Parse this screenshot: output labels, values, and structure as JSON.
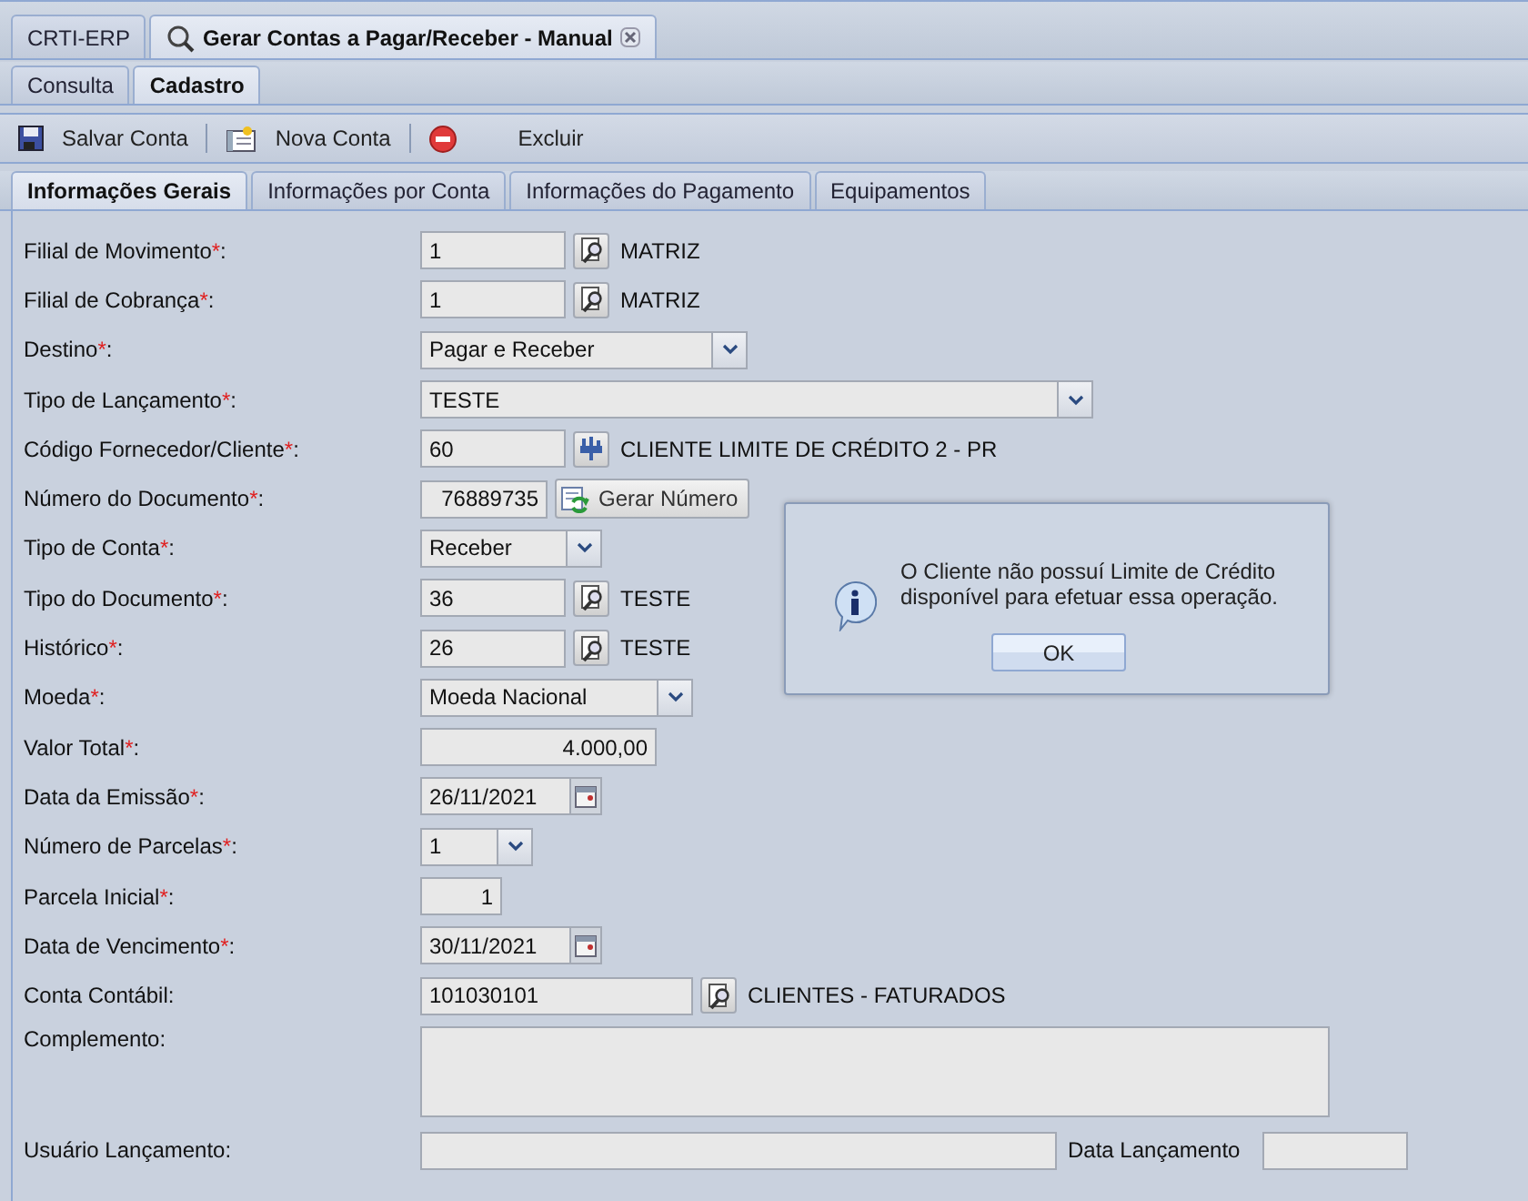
{
  "window_tabs": [
    {
      "label": "CRTI-ERP",
      "selected": false,
      "closable": false
    },
    {
      "label": "Gerar Contas a Pagar/Receber - Manual",
      "selected": true,
      "closable": true
    }
  ],
  "sub_tabs": [
    {
      "label": "Consulta",
      "selected": false
    },
    {
      "label": "Cadastro",
      "selected": true
    }
  ],
  "toolbar": [
    {
      "kind": "save",
      "label": "Salvar Conta"
    },
    {
      "kind": "new",
      "label": "Nova Conta"
    },
    {
      "kind": "delete",
      "label": "Excluir"
    }
  ],
  "form_tabs": [
    {
      "label": "Informações Gerais",
      "selected": true
    },
    {
      "label": "Informações por Conta",
      "selected": false
    },
    {
      "label": "Informações do Pagamento",
      "selected": false
    },
    {
      "label": "Equipamentos",
      "selected": false
    }
  ],
  "fields": [
    {
      "label": "Filial de Movimento",
      "mark": "*",
      "end": ":",
      "kind": "lookup",
      "value": "1",
      "description": "MATRIZ"
    },
    {
      "label": "Filial de Cobrança",
      "mark": "*",
      "end": ":",
      "kind": "lookup",
      "value": "1",
      "description": "MATRIZ"
    },
    {
      "label": "Destino",
      "mark": "*",
      "end": ":",
      "kind": "select",
      "value": "Pagar e Receber"
    },
    {
      "label": "Tipo de Lançamento",
      "mark": "*",
      "end": ":",
      "kind": "select",
      "value": "TESTE"
    },
    {
      "label": "Código Fornecedor/Cliente",
      "mark": "*",
      "end": ":",
      "kind": "client-lookup",
      "value": "60",
      "description": "CLIENTE LIMITE DE CRÉDITO 2 - PR"
    },
    {
      "label": "Número do Documento",
      "mark": "*",
      "end": ":",
      "kind": "generate",
      "value": "76889735",
      "button": "Gerar Número"
    },
    {
      "label": "Tipo de Conta",
      "mark": "*",
      "end": ":",
      "kind": "select",
      "value": "Receber"
    },
    {
      "label": "Tipo do Documento",
      "mark": "*",
      "end": ":",
      "kind": "lookup",
      "value": "36",
      "description": "TESTE"
    },
    {
      "label": "Histórico",
      "mark": "*",
      "end": ":",
      "kind": "lookup",
      "value": "26",
      "description": "TESTE"
    },
    {
      "label": "Moeda",
      "mark": "*",
      "end": ":",
      "kind": "select",
      "value": "Moeda Nacional"
    },
    {
      "label": "Valor Total",
      "mark": "*",
      "end": ":",
      "kind": "number",
      "value": "4.000,00"
    },
    {
      "label": "Data da Emissão",
      "mark": "*",
      "end": ":",
      "kind": "date",
      "value": "26/11/2021"
    },
    {
      "label": "Número de Parcelas",
      "mark": "*",
      "end": ":",
      "kind": "select",
      "value": "1"
    },
    {
      "label": "Parcela Inicial",
      "mark": "*",
      "end": ":",
      "kind": "number",
      "value": "1"
    },
    {
      "label": "Data de Vencimento",
      "mark": "*",
      "end": ":",
      "kind": "date",
      "value": "30/11/2021"
    },
    {
      "label": "Conta Contábil:",
      "kind": "lookup",
      "value": "101030101",
      "description": "CLIENTES - FATURADOS"
    },
    {
      "label": "Complemento:",
      "kind": "textarea"
    },
    {
      "label": "Usuário Lançamento:",
      "kind": "user-date",
      "second_label": "Data Lançamento"
    }
  ],
  "dialog": {
    "message": "O Cliente não possuí Limite de Crédito disponível para efetuar essa operação.",
    "button": "OK"
  }
}
